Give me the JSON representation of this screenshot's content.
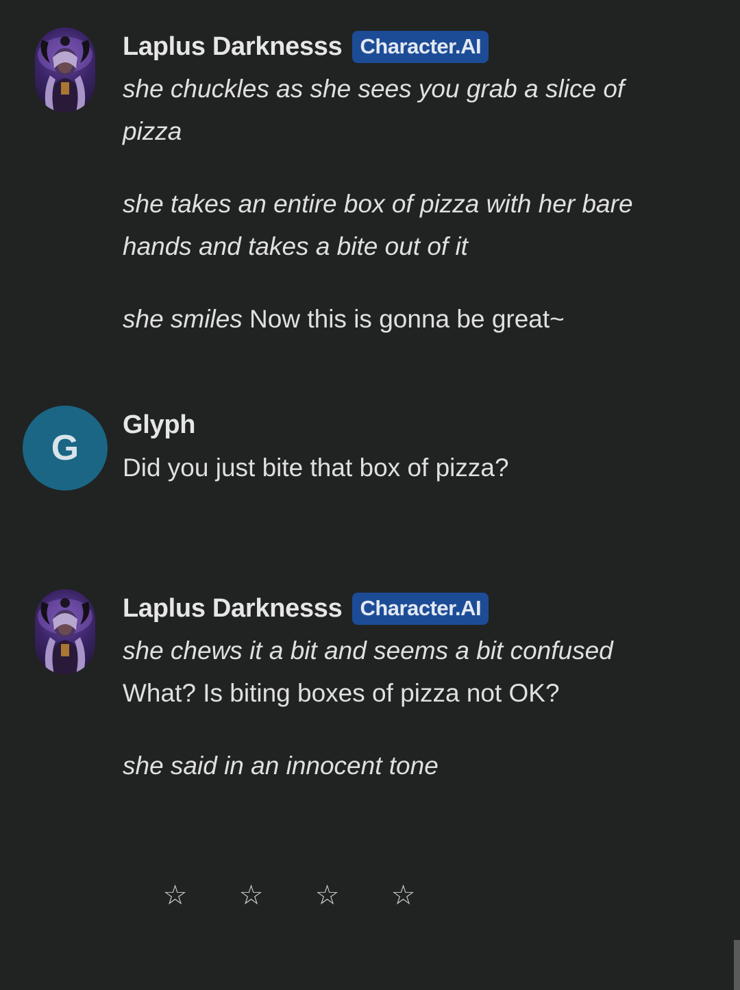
{
  "messages": [
    {
      "author": "Laplus Darknesss",
      "badge": "Character.AI",
      "paragraphs": [
        {
          "action": "she chuckles as she sees you grab a slice of pizza",
          "speech": ""
        },
        {
          "action": "she takes an entire box of pizza with her bare hands and takes a bite out of it",
          "speech": ""
        },
        {
          "action": "she smiles",
          "speech": " Now this is gonna be great~"
        }
      ]
    },
    {
      "author": "Glyph",
      "avatar_letter": "G",
      "text": "Did you just bite that box of pizza?"
    },
    {
      "author": "Laplus Darknesss",
      "badge": "Character.AI",
      "paragraphs": [
        {
          "action": "she chews it a bit and seems a bit confused",
          "speech": " What? Is biting boxes of pizza not OK?"
        },
        {
          "action": "she said in an innocent tone",
          "speech": ""
        }
      ]
    }
  ],
  "rating": {
    "stars": [
      "☆",
      "☆",
      "☆",
      "☆"
    ]
  },
  "colors": {
    "background": "#212222",
    "badge": "#1d4c97",
    "user_avatar": "#1a6684"
  },
  "icons": {
    "rating_star": "star-outline-icon"
  }
}
